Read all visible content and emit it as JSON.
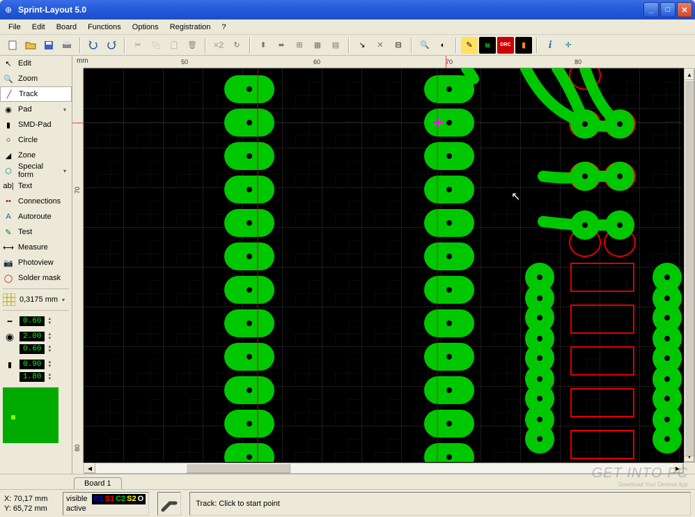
{
  "title": "Sprint-Layout 5.0",
  "menu": [
    "File",
    "Edit",
    "Board",
    "Functions",
    "Options",
    "Registration",
    "?"
  ],
  "tools": [
    {
      "id": "edit",
      "label": "Edit",
      "icon": "↖",
      "color": "#000"
    },
    {
      "id": "zoom",
      "label": "Zoom",
      "icon": "🔍",
      "color": "#000"
    },
    {
      "id": "track",
      "label": "Track",
      "icon": "╱",
      "color": "#c00060",
      "sel": true
    },
    {
      "id": "pad",
      "label": "Pad",
      "icon": "◉",
      "color": "#000",
      "dd": true
    },
    {
      "id": "smd",
      "label": "SMD-Pad",
      "icon": "▮",
      "color": "#000"
    },
    {
      "id": "circle",
      "label": "Circle",
      "icon": "○",
      "color": "#000"
    },
    {
      "id": "zone",
      "label": "Zone",
      "icon": "◢",
      "color": "#000"
    },
    {
      "id": "special",
      "label": "Special form",
      "icon": "⬡",
      "color": "#008080",
      "dd": true
    },
    {
      "id": "text",
      "label": "Text",
      "icon": "ab|",
      "color": "#000"
    },
    {
      "id": "connections",
      "label": "Connections",
      "icon": "••",
      "color": "#c00060"
    },
    {
      "id": "autoroute",
      "label": "Autoroute",
      "icon": "A",
      "color": "#0060c0"
    },
    {
      "id": "test",
      "label": "Test",
      "icon": "✎",
      "color": "#008000"
    },
    {
      "id": "measure",
      "label": "Measure",
      "icon": "⟷",
      "color": "#000"
    },
    {
      "id": "photoview",
      "label": "Photoview",
      "icon": "📷",
      "color": "#606060"
    },
    {
      "id": "soldermask",
      "label": "Solder mask",
      "icon": "◯",
      "color": "#c00000"
    }
  ],
  "grid_value": "0,3175 mm",
  "params": {
    "track_width": "0.60",
    "pad_outer": "2.00",
    "pad_inner": "0.60",
    "smd_w": "0.90",
    "smd_h": "1.80"
  },
  "ruler_unit": "mm",
  "ruler_h": [
    "50",
    "60",
    "70",
    "80"
  ],
  "ruler_v": [
    "70",
    "80"
  ],
  "tab": "Board 1",
  "status": {
    "x_label": "X:",
    "x": "70,17 mm",
    "y_label": "Y:",
    "y": "65,72 mm",
    "visible": "visible",
    "active": "active",
    "layers": {
      "c1": "C1",
      "s1": "S1",
      "c2": "C2",
      "s2": "S2",
      "o": "O"
    },
    "message": "Track: Click to start point"
  },
  "watermark": {
    "line1": "GET INTO PC",
    "line2": "Download Your Desired App"
  }
}
